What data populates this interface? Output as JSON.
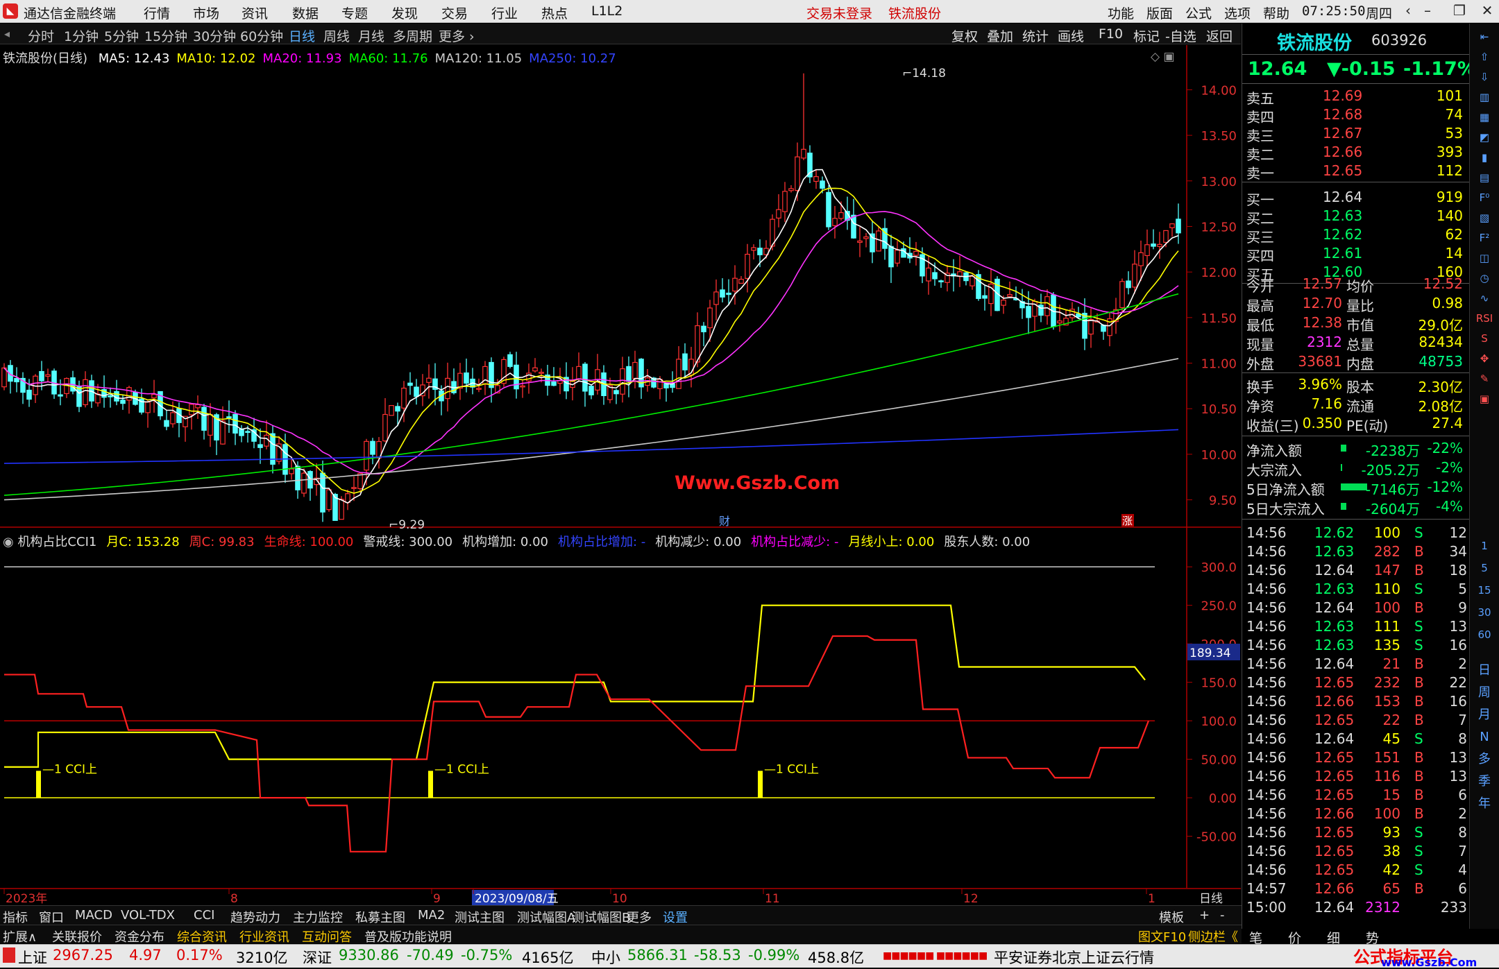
{
  "app": {
    "title": "通达信金融终端",
    "menus": [
      "行情",
      "市场",
      "资讯",
      "数据",
      "专题",
      "发现",
      "交易",
      "行业",
      "热点",
      "L1L2"
    ],
    "login_status": "交易未登录",
    "stock_title": "铁流股份",
    "right_menus": [
      "功能",
      "版面",
      "公式",
      "选项",
      "帮助"
    ],
    "time": "07:25:50",
    "weekday": "周四"
  },
  "periods": [
    "分时",
    "1分钟",
    "5分钟",
    "15分钟",
    "30分钟",
    "60分钟",
    "日线",
    "周线",
    "月线",
    "多周期",
    "更多 ›"
  ],
  "selected_period": "日线",
  "toolbar": [
    "复权",
    "叠加",
    "统计",
    "画线",
    "F10",
    "标记",
    "-自选",
    "返回"
  ],
  "main_legend": {
    "name": "铁流股份(日线)",
    "ma": [
      {
        "label": "MA5: 12.43",
        "color": "#ffffff"
      },
      {
        "label": "MA10: 12.02",
        "color": "#ffff00"
      },
      {
        "label": "MA20: 11.93",
        "color": "#ff00ff"
      },
      {
        "label": "MA60: 11.76",
        "color": "#00ff00"
      },
      {
        "label": "MA120: 11.05",
        "color": "#cccccc"
      },
      {
        "label": "MA250: 10.27",
        "color": "#3344ff"
      }
    ]
  },
  "price_axis": [
    "14.00",
    "13.50",
    "13.00",
    "12.50",
    "12.00",
    "11.50",
    "11.00",
    "10.50",
    "10.00",
    "9.50"
  ],
  "high_label": "14.18",
  "low_label": "9.29",
  "watermark": "Www.Gszb.Com",
  "cai_label": "财",
  "zhang_label": "涨",
  "ind_legend": [
    {
      "t": "机构占比CCI1",
      "c": "#dddddd"
    },
    {
      "t": "月C: 153.28",
      "c": "#ffff00"
    },
    {
      "t": "周C: 99.83",
      "c": "#ff3333"
    },
    {
      "t": "生命线: 100.00",
      "c": "#ff2222"
    },
    {
      "t": "警戒线: 300.00",
      "c": "#dddddd"
    },
    {
      "t": "机构增加: 0.00",
      "c": "#dddddd"
    },
    {
      "t": "机构占比增加: -",
      "c": "#3344ff"
    },
    {
      "t": "机构减少: 0.00",
      "c": "#dddddd"
    },
    {
      "t": "机构占比减少: -",
      "c": "#ff00ff"
    },
    {
      "t": "月线小上: 0.00",
      "c": "#ffff00"
    },
    {
      "t": "股东人数: 0.00",
      "c": "#dddddd"
    }
  ],
  "ind_axis": [
    "300.0",
    "250.0",
    "200.0",
    "150.0",
    "100.0",
    "50.00",
    "0.00",
    "-50.00"
  ],
  "ind_current": "189.34",
  "cci_label": "1 CCI上",
  "date_axis": {
    "labels": [
      "2023年",
      "8",
      "9",
      "2023/09/08/五",
      "10",
      "11",
      "12",
      "1"
    ],
    "right_label": "日线"
  },
  "chart_data": {
    "type": "candlestick",
    "title": "铁流股份(日线)",
    "y_range": [
      9.2,
      14.3
    ],
    "high": 14.18,
    "low": 9.29
  },
  "indicator_data": {
    "type": "line",
    "y_range": [
      -90,
      320
    ],
    "series": [
      {
        "name": "月C",
        "color": "#ffff00"
      },
      {
        "name": "周C",
        "color": "#ff3333"
      }
    ],
    "hlines": [
      {
        "name": "生命线",
        "value": 100
      },
      {
        "name": "警戒线",
        "value": 300
      }
    ]
  },
  "stock": {
    "name": "铁流股份",
    "code": "603926",
    "price": "12.64",
    "change": "▼-0.15",
    "pct": "-1.17%"
  },
  "asks": [
    {
      "l": "卖五",
      "p": "12.69",
      "v": "101"
    },
    {
      "l": "卖四",
      "p": "12.68",
      "v": "74"
    },
    {
      "l": "卖三",
      "p": "12.67",
      "v": "53"
    },
    {
      "l": "卖二",
      "p": "12.66",
      "v": "393"
    },
    {
      "l": "卖一",
      "p": "12.65",
      "v": "112"
    }
  ],
  "bids": [
    {
      "l": "买一",
      "p": "12.64",
      "v": "919"
    },
    {
      "l": "买二",
      "p": "12.63",
      "v": "140"
    },
    {
      "l": "买三",
      "p": "12.62",
      "v": "62"
    },
    {
      "l": "买四",
      "p": "12.61",
      "v": "14"
    },
    {
      "l": "买五",
      "p": "12.60",
      "v": "160"
    }
  ],
  "stats": [
    {
      "a": "今开",
      "b": "12.57",
      "bc": "#ff4444",
      "c": "均价",
      "d": "12.52",
      "dc": "#ff4444"
    },
    {
      "a": "最高",
      "b": "12.70",
      "bc": "#ff4444",
      "c": "量比",
      "d": "0.98",
      "dc": "#ffff00"
    },
    {
      "a": "最低",
      "b": "12.38",
      "bc": "#ff4444",
      "c": "市值",
      "d": "29.0亿",
      "dc": "#ffff00"
    },
    {
      "a": "现量",
      "b": "2312",
      "bc": "#ff33ff",
      "c": "总量",
      "d": "82434",
      "dc": "#ffff00"
    },
    {
      "a": "外盘",
      "b": "33681",
      "bc": "#ff4444",
      "c": "内盘",
      "d": "48753",
      "dc": "#00ff88"
    }
  ],
  "stats2": [
    {
      "a": "换手",
      "b": "3.96%",
      "c": "股本",
      "d": "2.30亿"
    },
    {
      "a": "净资",
      "b": "7.16",
      "c": "流通",
      "d": "2.08亿"
    },
    {
      "a": "收益(三)",
      "b": "0.350",
      "c": "PE(动)",
      "d": "27.4"
    }
  ],
  "flows": [
    {
      "l": "净流入额",
      "v": "-2238万",
      "p": "-22%"
    },
    {
      "l": "大宗流入",
      "v": "-205.2万",
      "p": "-2%"
    },
    {
      "l": "5日净流入额",
      "v": "-7146万",
      "p": "-12%"
    },
    {
      "l": "5日大宗流入",
      "v": "-2604万",
      "p": "-4%"
    }
  ],
  "ticks": [
    {
      "t": "14:56",
      "p": "12.62",
      "v": "100",
      "d": "S",
      "n": "12"
    },
    {
      "t": "14:56",
      "p": "12.63",
      "v": "282",
      "d": "B",
      "n": "34"
    },
    {
      "t": "14:56",
      "p": "12.64",
      "v": "147",
      "d": "B",
      "n": "18"
    },
    {
      "t": "14:56",
      "p": "12.63",
      "v": "110",
      "d": "S",
      "n": "5"
    },
    {
      "t": "14:56",
      "p": "12.64",
      "v": "100",
      "d": "B",
      "n": "9"
    },
    {
      "t": "14:56",
      "p": "12.63",
      "v": "111",
      "d": "S",
      "n": "13"
    },
    {
      "t": "14:56",
      "p": "12.63",
      "v": "135",
      "d": "S",
      "n": "16"
    },
    {
      "t": "14:56",
      "p": "12.64",
      "v": "21",
      "d": "B",
      "n": "2"
    },
    {
      "t": "14:56",
      "p": "12.65",
      "v": "232",
      "d": "B",
      "n": "22"
    },
    {
      "t": "14:56",
      "p": "12.66",
      "v": "153",
      "d": "B",
      "n": "16"
    },
    {
      "t": "14:56",
      "p": "12.65",
      "v": "22",
      "d": "B",
      "n": "7"
    },
    {
      "t": "14:56",
      "p": "12.64",
      "v": "45",
      "d": "S",
      "n": "8"
    },
    {
      "t": "14:56",
      "p": "12.65",
      "v": "151",
      "d": "B",
      "n": "13"
    },
    {
      "t": "14:56",
      "p": "12.65",
      "v": "116",
      "d": "B",
      "n": "13"
    },
    {
      "t": "14:56",
      "p": "12.65",
      "v": "15",
      "d": "B",
      "n": "6"
    },
    {
      "t": "14:56",
      "p": "12.66",
      "v": "100",
      "d": "B",
      "n": "2"
    },
    {
      "t": "14:56",
      "p": "12.65",
      "v": "93",
      "d": "S",
      "n": "8"
    },
    {
      "t": "14:56",
      "p": "12.65",
      "v": "38",
      "d": "S",
      "n": "7"
    },
    {
      "t": "14:56",
      "p": "12.65",
      "v": "42",
      "d": "S",
      "n": "4"
    },
    {
      "t": "14:57",
      "p": "12.66",
      "v": "65",
      "d": "B",
      "n": "6"
    },
    {
      "t": "15:00",
      "p": "12.64",
      "v": "2312",
      "d": "",
      "n": "233"
    }
  ],
  "rp_bottom": [
    "笔",
    "价",
    "细",
    "势"
  ],
  "sidebar": [
    "日",
    "周",
    "月",
    "N",
    "多",
    "季",
    "年"
  ],
  "sidebar_nums": [
    "1",
    "5",
    "15",
    "30",
    "60"
  ],
  "bottom1": [
    "指标",
    "窗口",
    "MACD",
    "VOL-TDX",
    "CCI",
    "趋势动力",
    "主力监控",
    "私募主图",
    "MA2",
    "测试主图",
    "测试幅图A",
    "测试幅图B",
    "更多",
    "设置"
  ],
  "bottom1_right": [
    "模板",
    "+",
    "-"
  ],
  "bottom2": [
    "扩展∧",
    "关联报价",
    "资金分布",
    "综合资讯",
    "行业资讯",
    "互动问答",
    "普及版功能说明"
  ],
  "bottom2_right": [
    "图文F10",
    "侧边栏《"
  ],
  "status": {
    "sh_label": "上证",
    "sh": "2967.25",
    "sh_chg": "4.97",
    "sh_pct": "0.17%",
    "sh_amt": "3210亿",
    "sz_label": "深证",
    "sz": "9330.86",
    "sz_chg": "-70.49",
    "sz_pct": "-0.75%",
    "sz_amt": "4165亿",
    "zx_label": "中小",
    "zx": "5866.31",
    "zx_chg": "-58.53",
    "zx_pct": "-0.99%",
    "zx_amt": "458.8亿",
    "broker": "平安证券北京上证云行情",
    "brand": "公式指标平台",
    "brand_url": "www.Gszb.Com"
  }
}
